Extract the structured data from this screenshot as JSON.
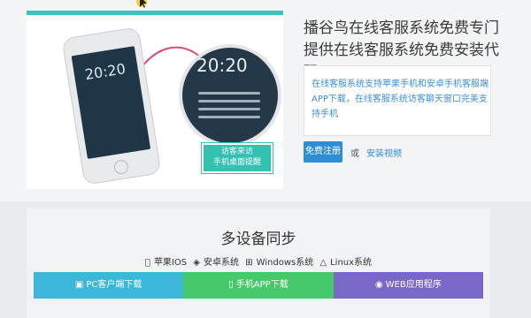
{
  "hero": {
    "phone_time": "20:20",
    "zoom_time": "20:20",
    "badge_line1": "访客来访",
    "badge_line2": "手机桌面提醒"
  },
  "info": {
    "title": "播谷鸟在线客服系统免费专门提供在线客服系统免费安装代码",
    "description": "在线客服系统支持苹果手机和安卓手机客服端APP下载，在线客服系统访客聊天窗口完美支持手机",
    "signup_label": "免费注册",
    "or_text": "或",
    "install_link": "安装视频"
  },
  "sync": {
    "title": "多设备同步",
    "platforms": [
      "苹果IOS",
      "安卓系统",
      "Windows系统",
      "Linux系统"
    ],
    "buttons": [
      "PC客户端下载",
      "手机APP下载",
      "WEB应用程序"
    ]
  },
  "colors": {
    "accent_teal": "#3cc3c0",
    "link_blue": "#2f8dd6",
    "pc_blue": "#3db7d9",
    "app_green": "#46c96a",
    "web_purple": "#7a68c8"
  }
}
